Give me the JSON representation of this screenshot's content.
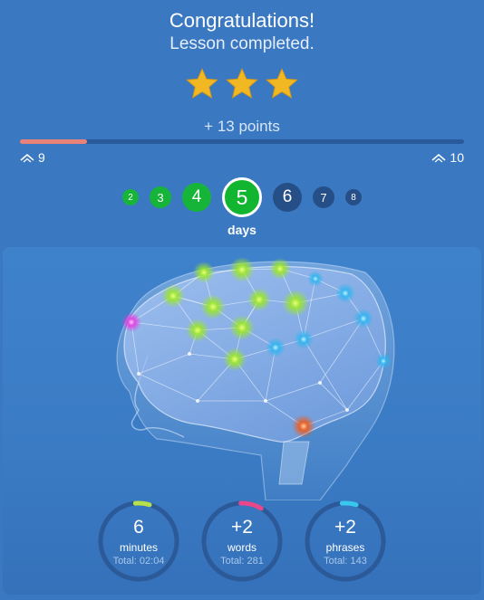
{
  "header": {
    "title": "Congratulations!",
    "subtitle": "Lesson completed."
  },
  "rating": {
    "stars": 3,
    "max": 3,
    "color": "#f2b824"
  },
  "points_text": "+ 13 points",
  "level_progress": {
    "current_level": "9",
    "next_level": "10",
    "fraction": 0.15,
    "fill_color": "#e8837a"
  },
  "streak": {
    "days": [
      "2",
      "3",
      "4",
      "5",
      "6",
      "7",
      "8"
    ],
    "today": "5",
    "label": "days",
    "past_color": "#16b53a",
    "future_color": "#264f88"
  },
  "stats": [
    {
      "value": "6",
      "unit": "minutes",
      "total": "Total: 02:04",
      "accent": "#b8e04a"
    },
    {
      "value": "+2",
      "unit": "words",
      "total": "Total: 281",
      "accent": "#e8488a"
    },
    {
      "value": "+2",
      "unit": "phrases",
      "total": "Total: 143",
      "accent": "#38c8ee"
    }
  ],
  "icons": {
    "star": "star-icon",
    "level": "chevron-up-icon",
    "illustration": "brain-network-illustration"
  }
}
